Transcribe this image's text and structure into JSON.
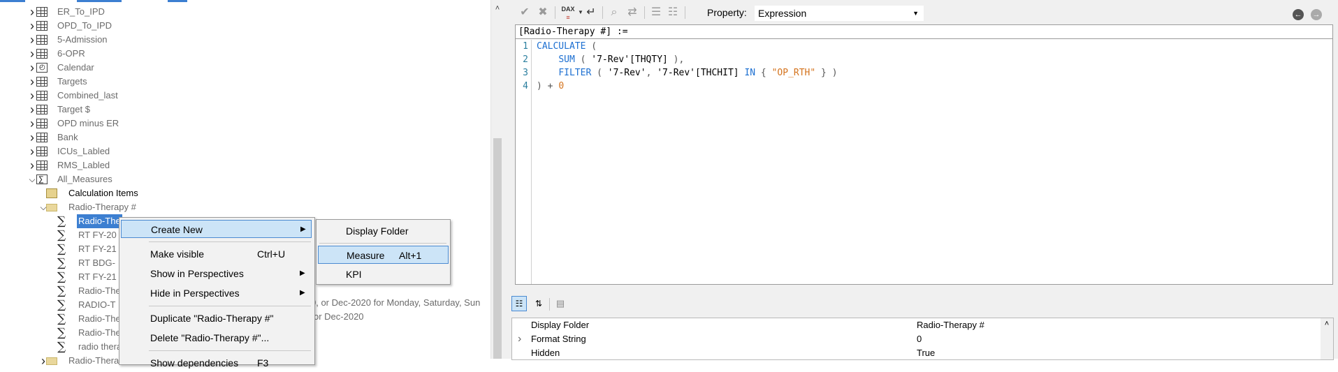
{
  "tree": {
    "items": [
      {
        "label": "ER_To_IPD",
        "icon": "table-icon",
        "level": 0,
        "expander": "chevron-right"
      },
      {
        "label": "OPD_To_IPD",
        "icon": "table-icon",
        "level": 0,
        "expander": "chevron-right"
      },
      {
        "label": "5-Admission",
        "icon": "table-icon",
        "level": 0,
        "expander": "chevron-right"
      },
      {
        "label": "6-OPR",
        "icon": "table-icon",
        "level": 0,
        "expander": "chevron-right"
      },
      {
        "label": "Calendar",
        "icon": "calendar-table-icon",
        "level": 0,
        "expander": "chevron-right"
      },
      {
        "label": "Targets",
        "icon": "table-icon",
        "level": 0,
        "expander": "chevron-right"
      },
      {
        "label": "Combined_last",
        "icon": "table-icon",
        "level": 0,
        "expander": "chevron-right"
      },
      {
        "label": "Target $",
        "icon": "table-icon",
        "level": 0,
        "expander": "chevron-right"
      },
      {
        "label": "OPD minus ER",
        "icon": "table-icon",
        "level": 0,
        "expander": "chevron-right"
      },
      {
        "label": "Bank",
        "icon": "table-icon",
        "level": 0,
        "expander": "chevron-right"
      },
      {
        "label": "ICUs_Labled",
        "icon": "table-icon",
        "level": 0,
        "expander": "chevron-right"
      },
      {
        "label": "RMS_Labled",
        "icon": "table-icon",
        "level": 0,
        "expander": "chevron-right"
      },
      {
        "label": "All_Measures",
        "icon": "measure-table-icon",
        "level": 0,
        "expander": "chevron-down"
      },
      {
        "label": "Calculation Items",
        "icon": "calculation-items-icon",
        "level": 1,
        "expander": "",
        "dark": true
      },
      {
        "label": "Radio-Therapy #",
        "icon": "folder-icon",
        "level": 1,
        "expander": "chevron-down"
      },
      {
        "label": "Radio-The",
        "icon": "measure-icon",
        "level": 2,
        "expander": "",
        "selected": true
      },
      {
        "label": "RT FY-20",
        "icon": "measure-icon",
        "level": 2,
        "expander": ""
      },
      {
        "label": "RT FY-21",
        "icon": "measure-icon",
        "level": 2,
        "expander": ""
      },
      {
        "label": "RT BDG-",
        "icon": "measure-icon",
        "level": 2,
        "expander": ""
      },
      {
        "label": "RT FY-21",
        "icon": "measure-icon",
        "level": 2,
        "expander": ""
      },
      {
        "label": "Radio-The",
        "icon": "measure-icon",
        "level": 2,
        "expander": ""
      },
      {
        "label": "RADIO-T",
        "icon": "measure-icon",
        "level": 2,
        "expander": ""
      },
      {
        "label": "Radio-The",
        "icon": "measure-icon",
        "level": 2,
        "expander": ""
      },
      {
        "label": "Radio-The",
        "icon": "measure-icon",
        "level": 2,
        "expander": ""
      },
      {
        "label": "radio thera",
        "icon": "measure-icon",
        "level": 2,
        "expander": ""
      },
      {
        "label": "Radio-Thera",
        "icon": "folder-icon",
        "level": 1,
        "expander": "chevron-right"
      }
    ],
    "descriptions": [
      "0, or Dec-2020 for Monday, Saturday, Sun",
      "or Dec-2020"
    ]
  },
  "context_menu": {
    "items": [
      {
        "label": "Create New",
        "shortcut": "",
        "submenu": true,
        "highlighted": true
      },
      {
        "separator": true
      },
      {
        "label": "Make visible",
        "shortcut": "Ctrl+U",
        "submenu": false
      },
      {
        "label": "Show in Perspectives",
        "shortcut": "",
        "submenu": true
      },
      {
        "label": "Hide in Perspectives",
        "shortcut": "",
        "submenu": true
      },
      {
        "separator": true
      },
      {
        "label": "Duplicate \"Radio-Therapy #\"",
        "shortcut": "",
        "submenu": false
      },
      {
        "label": "Delete \"Radio-Therapy #\"...",
        "shortcut": "",
        "submenu": false
      },
      {
        "separator": true
      },
      {
        "label": "Show dependencies",
        "shortcut": "F3",
        "submenu": false
      }
    ]
  },
  "submenu": {
    "items": [
      {
        "label": "Display Folder",
        "shortcut": ""
      },
      {
        "separator": true
      },
      {
        "label": "Measure",
        "shortcut": "Alt+1",
        "highlighted": true
      },
      {
        "label": "KPI",
        "shortcut": ""
      }
    ]
  },
  "toolbar": {
    "property_label": "Property:",
    "property_value": "Expression",
    "dax_label": "DAX"
  },
  "editor": {
    "header": "[Radio-Therapy #] :=",
    "line_numbers": [
      "1",
      "2",
      "3",
      "4"
    ],
    "lines": [
      [
        {
          "t": "CALCULATE",
          "c": "kw"
        },
        {
          "t": " (",
          "c": "op"
        }
      ],
      [
        {
          "t": "    ",
          "c": "op"
        },
        {
          "t": "SUM",
          "c": "kw"
        },
        {
          "t": " ( ",
          "c": "op"
        },
        {
          "t": "'7-Rev'[THQTY]",
          "c": "col"
        },
        {
          "t": " ),",
          "c": "op"
        }
      ],
      [
        {
          "t": "    ",
          "c": "op"
        },
        {
          "t": "FILTER",
          "c": "kw"
        },
        {
          "t": " ( ",
          "c": "op"
        },
        {
          "t": "'7-Rev'",
          "c": "col"
        },
        {
          "t": ", ",
          "c": "op"
        },
        {
          "t": "'7-Rev'[THCHIT]",
          "c": "col"
        },
        {
          "t": " ",
          "c": "op"
        },
        {
          "t": "IN",
          "c": "kw"
        },
        {
          "t": " { ",
          "c": "op"
        },
        {
          "t": "\"OP_RTH\"",
          "c": "strq"
        },
        {
          "t": " } )",
          "c": "op"
        }
      ],
      [
        {
          "t": ") + ",
          "c": "op"
        },
        {
          "t": "0",
          "c": "num"
        }
      ]
    ]
  },
  "properties": {
    "rows": [
      {
        "name": "Display Folder",
        "value": "Radio-Therapy #",
        "expandable": false
      },
      {
        "name": "Format String",
        "value": "0",
        "expandable": true
      },
      {
        "name": "Hidden",
        "value": "True",
        "expandable": false
      }
    ]
  },
  "colors": {
    "selection": "#3c7fd1",
    "menu_highlight": "#cce4f7",
    "keyword": "#1c6fd1",
    "string": "#d4731d"
  }
}
